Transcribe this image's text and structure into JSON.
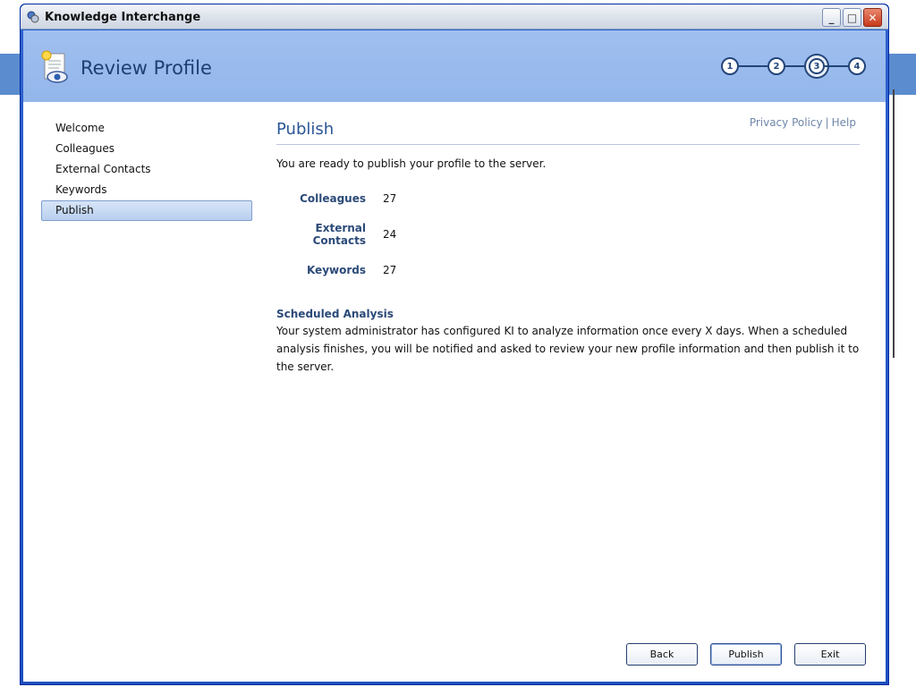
{
  "window": {
    "title": "Knowledge Interchange",
    "controls": {
      "minimize": "_",
      "maximize": "□",
      "close": "✕"
    }
  },
  "header": {
    "title": "Review Profile",
    "steps": [
      "1",
      "2",
      "3",
      "4"
    ],
    "current_step": "3"
  },
  "sidebar": {
    "items": [
      {
        "label": "Welcome"
      },
      {
        "label": "Colleagues"
      },
      {
        "label": "External Contacts"
      },
      {
        "label": "Keywords"
      },
      {
        "label": "Publish"
      }
    ],
    "active": "Publish"
  },
  "links": {
    "privacy": "Privacy Policy",
    "separator": "|",
    "help": "Help"
  },
  "content": {
    "heading": "Publish",
    "intro": "You are ready to publish your profile to the server.",
    "stats": [
      {
        "label": "Colleagues",
        "value": "27"
      },
      {
        "label": "External Contacts",
        "value": "24"
      },
      {
        "label": "Keywords",
        "value": "27"
      }
    ],
    "section_heading": "Scheduled Analysis",
    "section_text": "Your system administrator has configured KI to analyze information once every X days. When a scheduled analysis finishes, you will be notified and asked to review your new profile information and then publish it to the server."
  },
  "buttons": {
    "back": "Back",
    "publish": "Publish",
    "exit": "Exit"
  },
  "colors": {
    "header": "#9fbff0",
    "accent": "#2a5696",
    "titlebar": "#dfe4ec"
  }
}
